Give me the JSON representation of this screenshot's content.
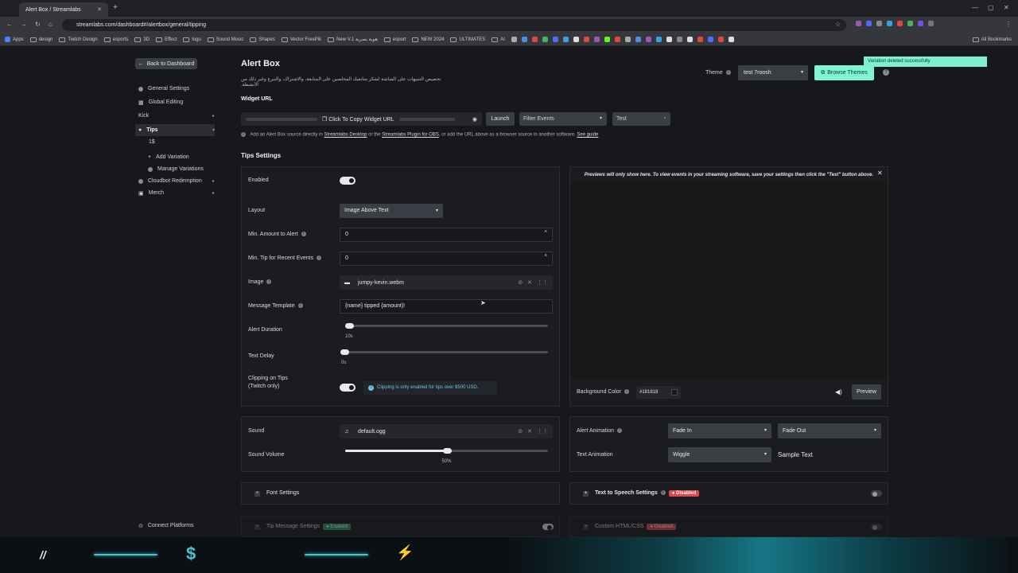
{
  "browser": {
    "tab_title": "Alert Box / Streamlabs",
    "url": "streamlabs.com/dashboard#/alertbox/general/tipping",
    "bookmarks": [
      "Apps",
      "design",
      "Twitch Design",
      "esports",
      "3D",
      "Effect",
      "logo",
      "Sound Music",
      "Shapes",
      "Vector FreePik",
      "New V.1 هوية بصرية",
      "esport",
      "NEW 2024",
      "ULTIMATES",
      "AI"
    ],
    "all_bookmarks": "All Bookmarks"
  },
  "sidebar": {
    "back": "Back to Dashboard",
    "items": [
      {
        "label": "General Settings"
      },
      {
        "label": "Global Editing"
      },
      {
        "label": "Kick"
      },
      {
        "label": "Tips"
      },
      {
        "label": "1$"
      },
      {
        "label": "Add Variation"
      },
      {
        "label": "Manage Variations"
      },
      {
        "label": "Cloudbot Redemption"
      },
      {
        "label": "Merch"
      }
    ],
    "connect": "Connect Platforms"
  },
  "header": {
    "title": "Alert Box",
    "subtitle": "تخصيص التنبيهات على الشاشة لشكر متابعيك المخلصين على المتابعة، والاشتراك، والتبرع وغير ذلك من الأنشطة.",
    "theme_label": "Theme",
    "theme_value": "test 7roosh",
    "browse_themes": "Browse Themes",
    "toast": "Variation deleted successfully"
  },
  "widget": {
    "label": "Widget URL",
    "copy": "Click To Copy Widget URL",
    "launch": "Launch",
    "filter": "Filter Events",
    "test": "Test",
    "info_pre": "Add an Alert Box source directly in",
    "info_link1": "Streamlabs Desktop",
    "info_mid": "or the",
    "info_link2": "Streamlabs Plugin for OBS",
    "info_post": ", or add the URL above as a browser source in another software.",
    "info_link3": "See guide"
  },
  "tips": {
    "heading": "Tips Settings",
    "enabled_label": "Enabled",
    "layout_label": "Layout",
    "layout_value": "Image Above Text",
    "min_amount_label": "Min. Amount to Alert",
    "min_amount_value": "0",
    "min_tip_label": "Min. Tip for Recent Events",
    "min_tip_value": "0",
    "image_label": "Image",
    "image_value": "jumpy-kevin.webm",
    "template_label": "Message Template",
    "template_value": "{name} tipped {amount}!",
    "duration_label": "Alert Duration",
    "duration_value": "10s",
    "delay_label": "Text Delay",
    "delay_value": "0s",
    "clipping_label_1": "Clipping on Tips",
    "clipping_label_2": "(Twitch only)",
    "clipping_note": "Clipping is only enabled for tips over $500 USD."
  },
  "preview": {
    "note": "Previews will only show here. To view events in your streaming software, save your settings then click the \"Test\" button above.",
    "bg_label": "Background Color",
    "bg_value": "#181818",
    "preview_btn": "Preview"
  },
  "sound": {
    "sound_label": "Sound",
    "sound_value": "default.ogg",
    "volume_label": "Sound Volume",
    "volume_value": "50%",
    "volume_level": 0.5
  },
  "animation": {
    "alert_label": "Alert Animation",
    "in_value": "Fade In",
    "out_value": "Fade Out",
    "text_label": "Text Animation",
    "text_value": "Wiggle",
    "sample": "Sample Text"
  },
  "sections": {
    "font": "Font Settings",
    "tts": "Text to Speech Settings",
    "tts_badge": "Disabled",
    "tipmsg": "Tip Message Settings",
    "tipmsg_badge": "Enabled",
    "custom": "Custom HTML/CSS",
    "custom_badge": "Disabled"
  },
  "colors": {
    "accent": "#80f5d2",
    "badge_red": "#e0484e",
    "info_blue": "#6fc2e6",
    "background": "#17181c"
  }
}
